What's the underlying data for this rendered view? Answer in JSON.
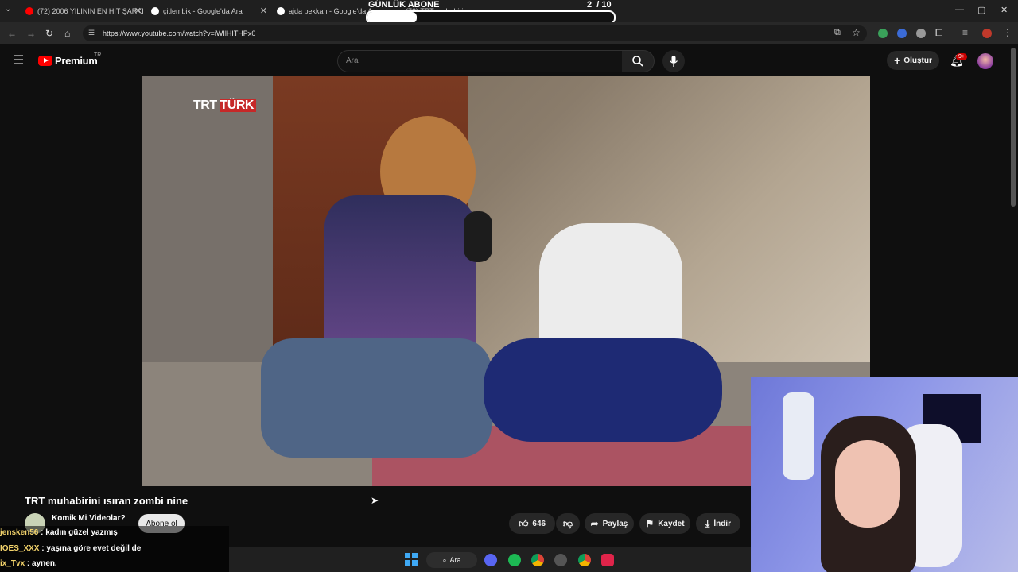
{
  "tabs": [
    {
      "title": "(72) 2006 YILININ EN HİT ŞARKI",
      "favicon_color": "#ff0000"
    },
    {
      "title": "çitlembik - Google'da Ara",
      "favicon_color": "#ffffff"
    },
    {
      "title": "ajda pekkan - Google'da Ara",
      "favicon_color": "#ffffff"
    },
    {
      "title": "(72) TRT muhabirini ısıran...",
      "favicon_color": "#ff0000"
    }
  ],
  "address_bar": {
    "url": "https://www.youtube.com/watch?v=iWIlHITHPx0"
  },
  "youtube": {
    "logo": "Premium",
    "region": "TR",
    "search_placeholder": "Ara",
    "create_label": "Oluştur",
    "notification_badge": "9+"
  },
  "video": {
    "title": "TRT muhabirini ısıran zombi nine",
    "watermark": "TRT TÜRK",
    "channel_name": "Komik Mi Videolar?",
    "subscribe_label": "Abone ol",
    "likes": "646",
    "share_label": "Paylaş",
    "save_label": "Kaydet",
    "download_label": "İndir"
  },
  "overlay": {
    "goal_title": "GÜNLÜK ABONE",
    "goal_progress": "2  / 10",
    "goal_fraction": 0.2
  },
  "chat": [
    {
      "user": "jensken56",
      "message": " : kadın güzel yazmış"
    },
    {
      "user": "IOES_XXX",
      "message": " : yaşına göre evet değil de"
    },
    {
      "user": "ix_Tvx",
      "message": " : aynen."
    }
  ],
  "taskbar": {
    "search_label": "Ara"
  },
  "icons": [
    "menu-icon",
    "youtube-logo-icon",
    "search-icon",
    "mic-icon",
    "plus-icon",
    "bell-icon",
    "like-icon",
    "dislike-icon",
    "share-icon",
    "bookmark-icon",
    "download-icon",
    "windows-start-icon"
  ],
  "colors": {
    "accent": "#ff0000",
    "chat_user": "#f3d36b",
    "background": "#0f0f0f"
  }
}
